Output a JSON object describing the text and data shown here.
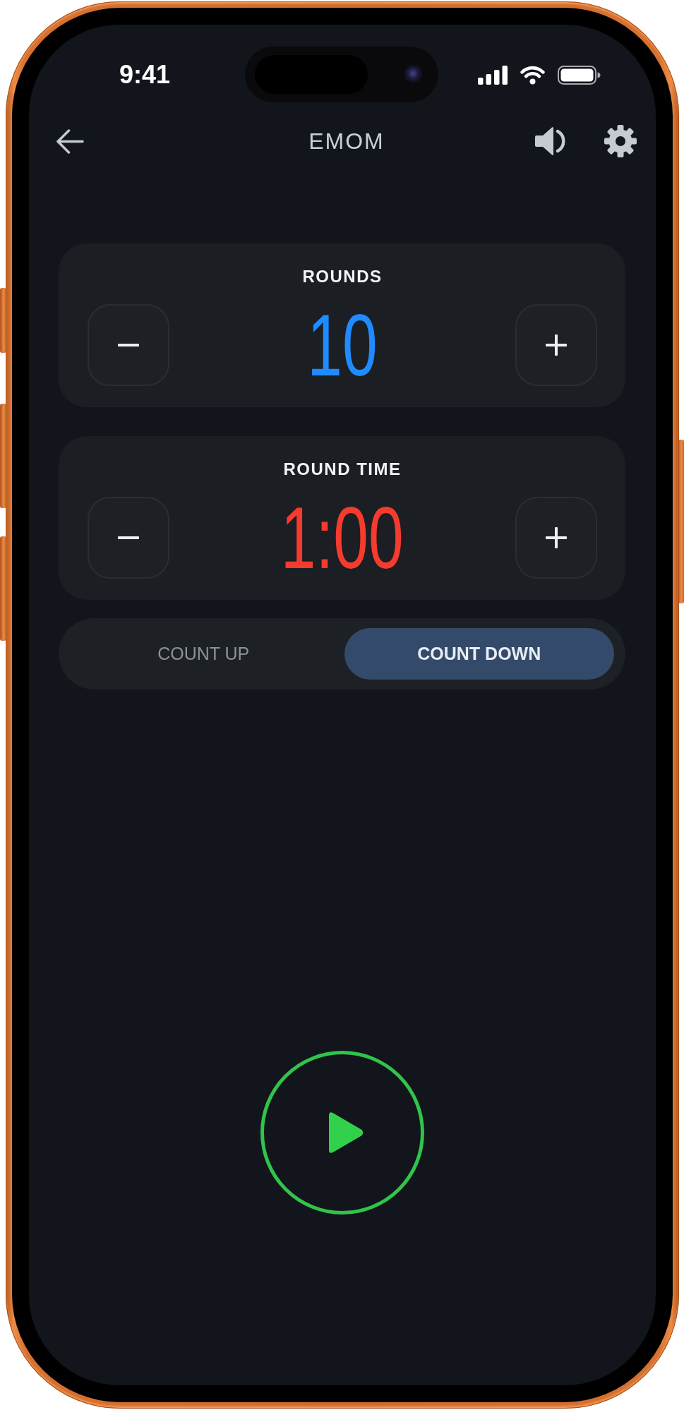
{
  "status_bar": {
    "time": "9:41"
  },
  "header": {
    "title": "EMOM"
  },
  "cards": [
    {
      "label": "ROUNDS",
      "value": "10",
      "color": "#1f8bff"
    },
    {
      "label": "ROUND TIME",
      "value": "1:00",
      "color": "#f53b2e"
    }
  ],
  "mode_toggle": [
    {
      "label": "COUNT UP",
      "selected": false
    },
    {
      "label": "COUNT DOWN",
      "selected": true
    }
  ]
}
